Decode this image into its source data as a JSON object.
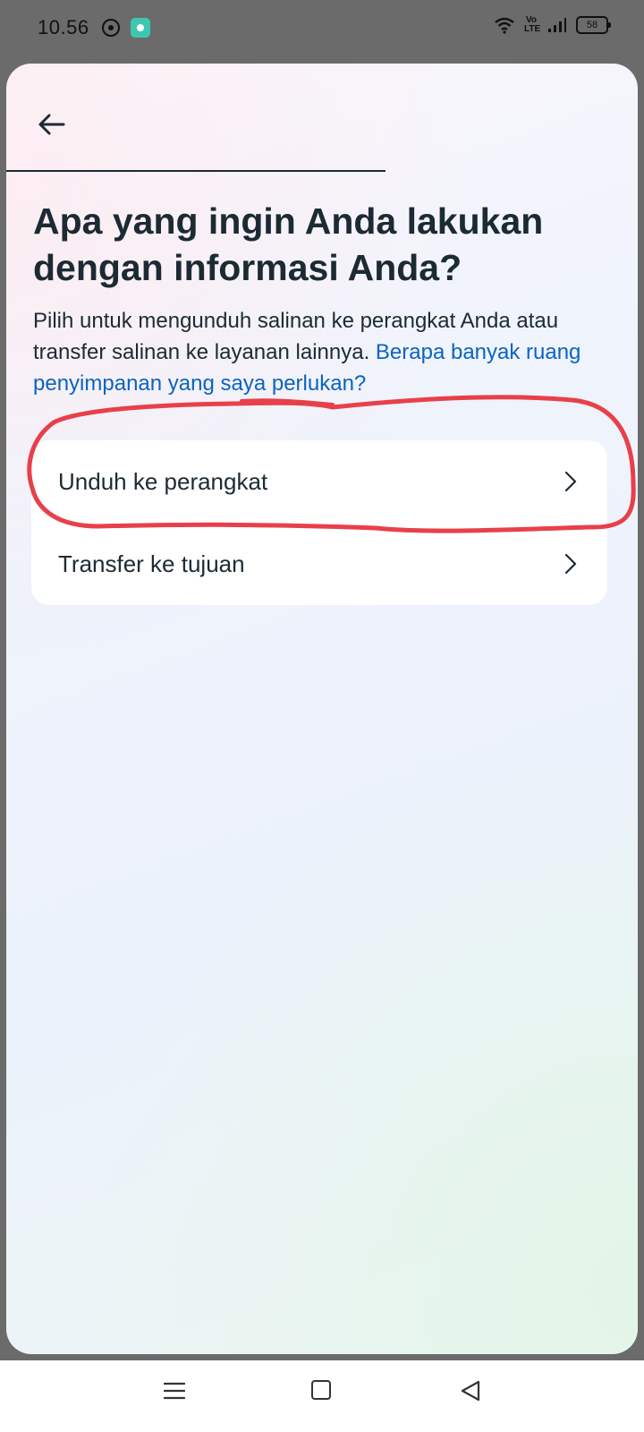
{
  "status_bar": {
    "time": "10.56",
    "volte": "Vo\nLTE",
    "battery": "58",
    "icons": [
      "whatsapp-icon",
      "app-badge-icon",
      "wifi-icon",
      "volte-icon",
      "signal-icon",
      "battery-icon"
    ]
  },
  "header": {
    "back_icon": "arrow-left-icon"
  },
  "main": {
    "title": "Apa yang ingin Anda lakukan dengan informasi Anda?",
    "description": "Pilih untuk mengunduh salinan ke perangkat Anda atau transfer salinan ke layanan lainnya.",
    "help_link": "Berapa banyak ruang penyimpanan yang saya perlukan?",
    "options": [
      {
        "label": "Unduh ke perangkat",
        "icon": "chevron-right-icon"
      },
      {
        "label": "Transfer ke tujuan",
        "icon": "chevron-right-icon"
      }
    ]
  },
  "colors": {
    "text": "#1c2b33",
    "link": "#0a64c2",
    "annotation": "#e8404a",
    "app_badge": "#3ec7b0"
  },
  "nav_bar": {
    "icons": [
      "menu-icon",
      "home-square-icon",
      "back-triangle-icon"
    ]
  }
}
